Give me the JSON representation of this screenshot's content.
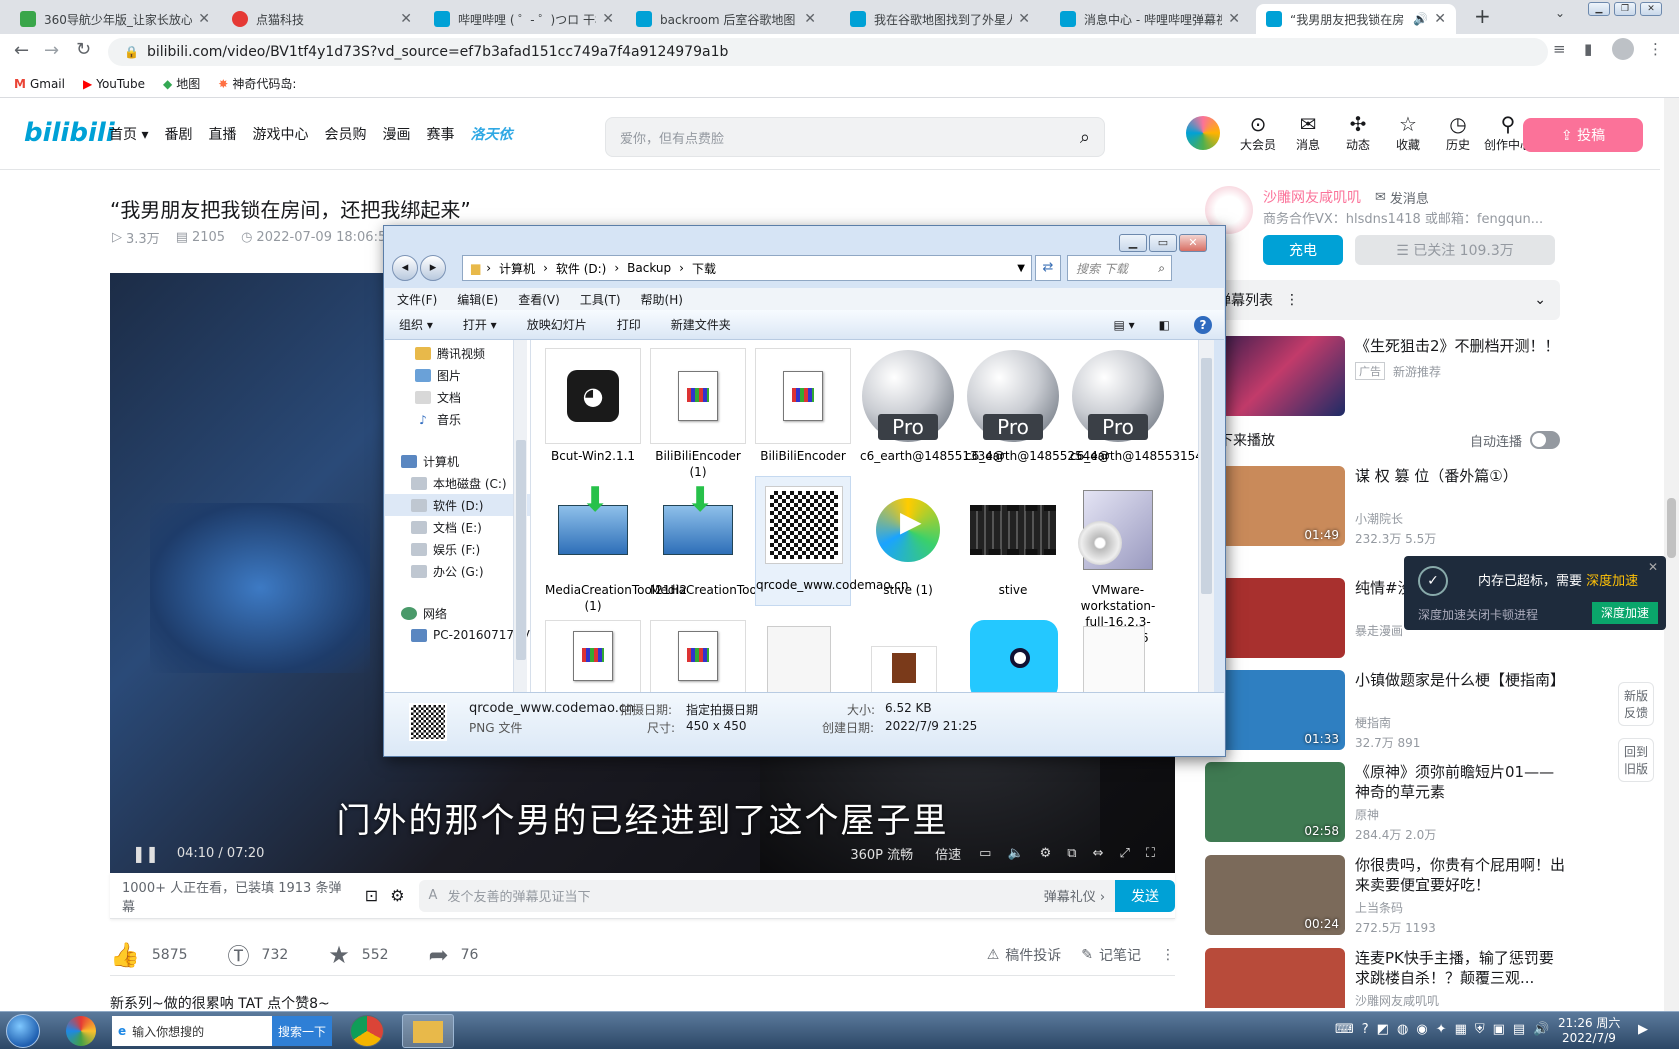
{
  "browser": {
    "tabs": [
      {
        "title": "360导航少年版_让家长放心",
        "color": "#3aa64a"
      },
      {
        "title": "点猫科技",
        "color": "#e53935"
      },
      {
        "title": "哔哩哔哩 ( ゜- ゜)つロ 干杯",
        "color": "#00a1d6"
      },
      {
        "title": "backroom 后室谷歌地图",
        "color": "#00a1d6"
      },
      {
        "title": "我在谷歌地图找到了外星人",
        "color": "#00a1d6"
      },
      {
        "title": "消息中心 - 哔哩哔哩弹幕视",
        "color": "#00a1d6"
      },
      {
        "title": "“我男朋友把我锁在房",
        "color": "#00a1d6"
      }
    ],
    "new_tab": "+",
    "url": "bilibili.com/video/BV1tf4y1d73S?vd_source=ef7b3afad151cc749a7f4a9124979a1b",
    "bookmarks": [
      "Gmail",
      "YouTube",
      "地图",
      "神奇代码岛:"
    ]
  },
  "header": {
    "logo": "bilibili",
    "nav": [
      "首页 ▾",
      "番剧",
      "直播",
      "游戏中心",
      "会员购",
      "漫画",
      "赛事",
      "洛天依"
    ],
    "search_placeholder": "爱你，但有点费脸",
    "icons": [
      {
        "g": "⊙",
        "l": "大会员"
      },
      {
        "g": "✉",
        "l": "消息"
      },
      {
        "g": "✣",
        "l": "动态"
      },
      {
        "g": "☆",
        "l": "收藏"
      },
      {
        "g": "◷",
        "l": "历史"
      },
      {
        "g": "⚲",
        "l": "创作中心"
      }
    ],
    "upload": "⇪ 投稿"
  },
  "video": {
    "title": "“我男朋友把我锁在房间，还把我绑起来”",
    "views": "3.3万",
    "danmaku": "2105",
    "date": "2022-07-09 18:06:5",
    "subtitle": "门外的那个男的已经进到了这个屋子里",
    "time": "04:10 / 07:20",
    "quality": "360P 流畅",
    "speed": "倍速",
    "watching": "1000+ 人正在看，已装填 1913 条弹幕",
    "danmaku_placeholder": "发个友善的弹幕见证当下",
    "etiquette": "弹幕礼仪 ›",
    "send": "发送",
    "likes": "5875",
    "coins": "732",
    "favs": "552",
    "shares": "76",
    "report": "稿件投诉",
    "notes": "记笔记",
    "desc": "新系列~做的很累呐 TAT 点个赞8~"
  },
  "up": {
    "name": "沙雕网友咸叽叽",
    "msg": "发消息",
    "bio": "商务合作VX：hlsdns1418 或邮箱：fengqun...",
    "charge": "充电",
    "follow": "☰ 已关注 109.3万"
  },
  "sidebar": {
    "danmaku_list": "弹幕列表",
    "ad_title": "《生死狙击2》不删档开测！！",
    "ad_tag": "广告",
    "ad_src": "新游推荐",
    "next": "接下来播放",
    "autoplay": "自动连播",
    "cards": [
      {
        "title": "谋 权 篡 位（番外篇①）",
        "author": "小潮院长",
        "stats": "232.3万  5.5万",
        "dur": "01:49",
        "color": "#c98a5a"
      },
      {
        "title": "纯情#没... 没有那么...",
        "author": "暴走漫画",
        "stats": "",
        "dur": "",
        "color": "#a8302e"
      },
      {
        "title": "小镇做题家是什么梗【梗指南】",
        "author": "梗指南",
        "stats": "32.7万  891",
        "dur": "01:33",
        "color": "#2f7fc1"
      },
      {
        "title": "《原神》须弥前瞻短片01——神奇的草元素",
        "author": "原神",
        "stats": "284.4万  2.0万",
        "dur": "02:58",
        "color": "#3f7a52"
      },
      {
        "title": "你很贵吗，你贵有个屁用啊！出来卖要便宜要好吃！",
        "author": "上当条码",
        "stats": "272.5万  1193",
        "dur": "00:24",
        "color": "#7b6a5a"
      },
      {
        "title": "连麦PK快手主播，输了惩罚要求跳楼自杀！？颠覆三观...",
        "author": "沙雕网友咸叽叽",
        "stats": "",
        "dur": "",
        "color": "#b84b3a"
      }
    ],
    "side_btns": [
      "新版反馈",
      "回到旧版"
    ]
  },
  "popup": {
    "title": "内存已超标，需要",
    "accent": "深度加速",
    "sub": "深度加速关闭卡顿进程",
    "btn": "深度加速"
  },
  "explorer": {
    "crumbs": [
      "计算机",
      "软件 (D:)",
      "Backup",
      "下载"
    ],
    "search": "搜索 下载",
    "menu": [
      "文件(F)",
      "编辑(E)",
      "查看(V)",
      "工具(T)",
      "帮助(H)"
    ],
    "toolbar": [
      "组织 ▾",
      "打开 ▾",
      "放映幻灯片",
      "打印",
      "新建文件夹"
    ],
    "nav": [
      "腾讯视频",
      "图片",
      "文档",
      "音乐",
      "计算机",
      "本地磁盘 (C:)",
      "软件 (D:)",
      "文档 (E:)",
      "娱乐 (F:)",
      "办公 (G:)",
      "网络",
      "PC-20160717EV"
    ],
    "files": [
      "Bcut-Win2.1.1",
      "BiliBiliEncoder (1)",
      "BiliBiliEncoder",
      "c6_earth@148551334@",
      "c6_earth@148552544@",
      "c6_earth@148553154@",
      "MediaCreationTool21H2 (1)",
      "MediaCreationTool21H2",
      "qrcode_www.codemao.cn",
      "stive (1)",
      "stive",
      "VMware-workstation-full-16.2.3-19376536"
    ],
    "pro": "Pro",
    "status": {
      "name": "qrcode_www.codemao.cn",
      "type": "PNG 文件",
      "date_label": "拍摄日期:",
      "date_val": "指定拍摄日期",
      "dim_label": "尺寸:",
      "dim_val": "450 x 450",
      "size_label": "大小:",
      "size_val": "6.52 KB",
      "created_label": "创建日期:",
      "created_val": "2022/7/9 21:25"
    }
  },
  "taskbar": {
    "search": "输入你想搜的",
    "search_btn": "搜索一下",
    "time": "21:26 周六",
    "date": "2022/7/9"
  }
}
